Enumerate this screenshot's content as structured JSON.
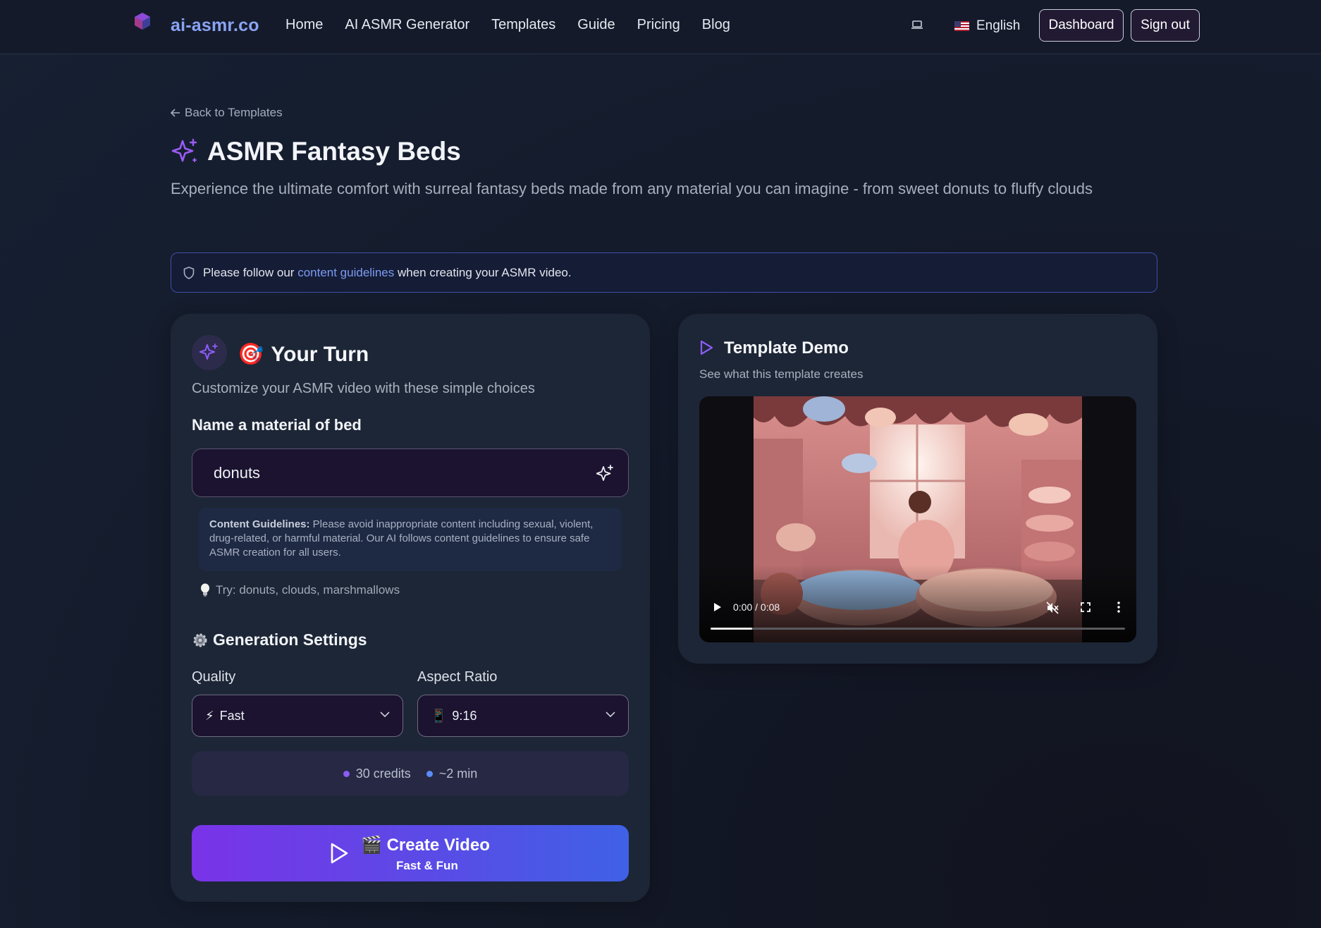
{
  "header": {
    "logo_text": "ai-asmr.co",
    "nav": [
      "Home",
      "AI ASMR Generator",
      "Templates",
      "Guide",
      "Pricing",
      "Blog"
    ],
    "language": "English",
    "dashboard_label": "Dashboard",
    "signout_label": "Sign out"
  },
  "page": {
    "back_label": "Back to Templates",
    "title": "ASMR Fantasy Beds",
    "subtitle": "Experience the ultimate comfort with surreal fantasy beds made from any material you can imagine - from sweet donuts to fluffy clouds",
    "notice_prefix": "Please follow our ",
    "notice_link": "content guidelines",
    "notice_suffix": " when creating your ASMR video."
  },
  "your_turn": {
    "title_emoji": "🎯",
    "title": "Your Turn",
    "subtitle": "Customize your ASMR video with these simple choices",
    "field_label": "Name a material of bed",
    "field_value": "donuts",
    "guidelines_bold": "Content Guidelines:",
    "guidelines_text": " Please avoid inappropriate content including sexual, violent, drug-related, or harmful material. Our AI follows content guidelines to ensure safe ASMR creation for all users.",
    "try_text": "Try: donuts, clouds, marshmallows"
  },
  "settings": {
    "title": "Generation Settings",
    "quality_label": "Quality",
    "quality_emoji": "⚡",
    "quality_value": "Fast",
    "aspect_label": "Aspect Ratio",
    "aspect_emoji": "📱",
    "aspect_value": "9:16",
    "credits": "30 credits",
    "duration": "~2 min"
  },
  "create": {
    "emoji": "🎬",
    "label": "Create Video",
    "sublabel": "Fast & Fun"
  },
  "demo": {
    "title": "Template Demo",
    "subtitle": "See what this template creates",
    "time": "0:00 / 0:08",
    "progress": 0.1
  },
  "colors": {
    "accent": "#8b5cf6",
    "link": "#7d9bf2",
    "credits_dot": "#8b5cf6",
    "time_dot": "#5b8cf6"
  }
}
